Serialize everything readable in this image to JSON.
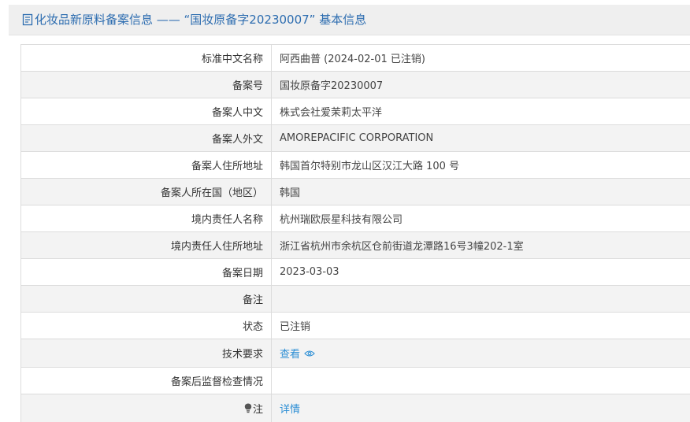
{
  "header": {
    "icon": "document-icon",
    "title": "化妆品新原料备案信息 —— “国妆原备字20230007” 基本信息",
    "accent_color": "#2d6db0"
  },
  "rows": [
    {
      "label": "标准中文名称",
      "value": "阿西曲普 (2024-02-01 已注销)"
    },
    {
      "label": "备案号",
      "value": "国妆原备字20230007"
    },
    {
      "label": "备案人中文",
      "value": "株式会社爱茉莉太平洋"
    },
    {
      "label": "备案人外文",
      "value": "AMOREPACIFIC CORPORATION"
    },
    {
      "label": "备案人住所地址",
      "value": "韩国首尔特别市龙山区汉江大路 100 号"
    },
    {
      "label": "备案人所在国（地区）",
      "value": "韩国"
    },
    {
      "label": "境内责任人名称",
      "value": "杭州瑞欧辰星科技有限公司"
    },
    {
      "label": "境内责任人住所地址",
      "value": "浙江省杭州市余杭区仓前街道龙潭路16号3幢202-1室"
    },
    {
      "label": "备案日期",
      "value": "2023-03-03"
    },
    {
      "label": "备注",
      "value": ""
    },
    {
      "label": "状态",
      "value": "已注销"
    },
    {
      "label": "技术要求",
      "link": "查看",
      "icon": "eye-icon"
    },
    {
      "label": "备案后监督检查情况",
      "value": ""
    },
    {
      "label": "注",
      "label_icon": "lightbulb-icon",
      "link": "详情"
    }
  ],
  "link_color": "#2d8fd5"
}
